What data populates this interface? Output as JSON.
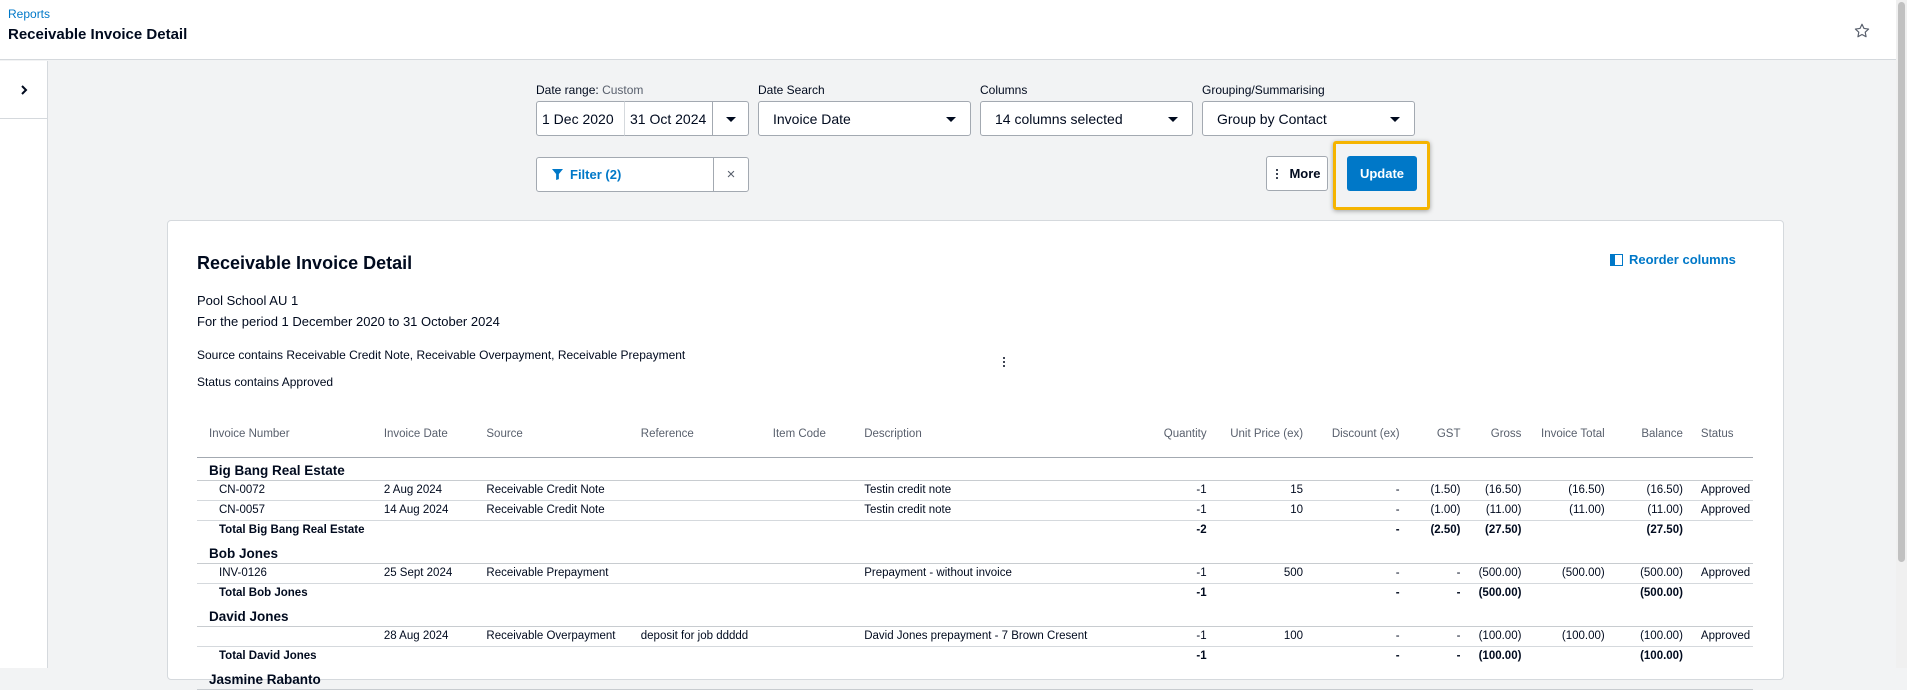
{
  "header": {
    "breadcrumb": "Reports",
    "title": "Receivable Invoice Detail"
  },
  "icons": {
    "star": "star-icon",
    "sidebar_toggle": "chevron-right-icon"
  },
  "colors": {
    "accent": "#0078c8",
    "highlight": "#f5b400"
  },
  "filters": {
    "date_range_label": "Date range:",
    "date_range_mode": "Custom",
    "date_from": "1 Dec 2020",
    "date_to": "31 Oct 2024",
    "date_search_label": "Date Search",
    "date_search_value": "Invoice Date",
    "columns_label": "Columns",
    "columns_value": "14 columns selected",
    "grouping_label": "Grouping/Summarising",
    "grouping_value": "Group by Contact",
    "filter_button": "Filter (2)",
    "clear_icon": "×",
    "more_button": "More",
    "update_button": "Update"
  },
  "report": {
    "title": "Receivable Invoice Detail",
    "org": "Pool School AU 1",
    "period": "For the period 1 December 2020 to 31 October 2024",
    "source_filter": "Source contains Receivable Credit Note, Receivable Overpayment, Receivable Prepayment",
    "status_filter": "Status contains Approved",
    "reorder": "Reorder columns",
    "columns": [
      "Invoice Number",
      "Invoice Date",
      "Source",
      "Reference",
      "Item Code",
      "Description",
      "Quantity",
      "Unit Price (ex)",
      "Discount (ex)",
      "GST",
      "Gross",
      "Invoice Total",
      "Balance",
      "Status"
    ],
    "groups": [
      {
        "name": "Big Bang Real Estate",
        "rows": [
          [
            "CN-0072",
            "2 Aug 2024",
            "Receivable Credit Note",
            "",
            "",
            "Testin credit note",
            "-1",
            "15",
            "-",
            "(1.50)",
            "(16.50)",
            "(16.50)",
            "(16.50)",
            "Approved"
          ],
          [
            "CN-0057",
            "14 Aug 2024",
            "Receivable Credit Note",
            "",
            "",
            "Testin credit note",
            "-1",
            "10",
            "-",
            "(1.00)",
            "(11.00)",
            "(11.00)",
            "(11.00)",
            "Approved"
          ]
        ],
        "total": [
          "Total Big Bang Real Estate",
          "",
          "",
          "",
          "",
          "",
          "-2",
          "",
          "-",
          "(2.50)",
          "(27.50)",
          "",
          "(27.50)",
          ""
        ]
      },
      {
        "name": "Bob Jones",
        "rows": [
          [
            "INV-0126",
            "25 Sept 2024",
            "Receivable Prepayment",
            "",
            "",
            "Prepayment - without invoice",
            "-1",
            "500",
            "-",
            "-",
            "(500.00)",
            "(500.00)",
            "(500.00)",
            "Approved"
          ]
        ],
        "total": [
          "Total Bob Jones",
          "",
          "",
          "",
          "",
          "",
          "-1",
          "",
          "-",
          "-",
          "(500.00)",
          "",
          "(500.00)",
          ""
        ]
      },
      {
        "name": "David Jones",
        "rows": [
          [
            "",
            "28 Aug 2024",
            "Receivable Overpayment",
            "deposit for job ddddd",
            "",
            "David Jones prepayment - 7 Brown Cresent",
            "-1",
            "100",
            "-",
            "-",
            "(100.00)",
            "(100.00)",
            "(100.00)",
            "Approved"
          ]
        ],
        "total": [
          "Total David Jones",
          "",
          "",
          "",
          "",
          "",
          "-1",
          "",
          "-",
          "-",
          "(100.00)",
          "",
          "(100.00)",
          ""
        ]
      },
      {
        "name": "Jasmine Rabanto",
        "rows": [],
        "total": null
      }
    ]
  }
}
